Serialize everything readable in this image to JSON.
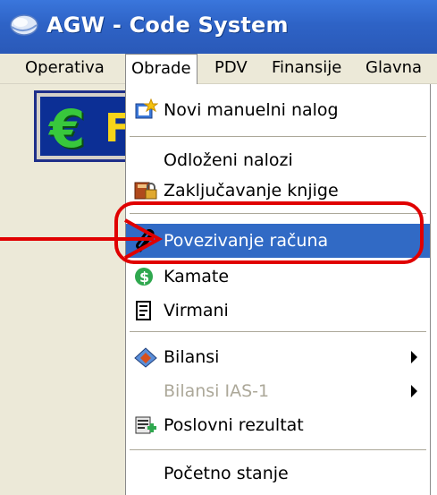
{
  "titlebar": {
    "title": "AGW - Code System",
    "icon": "app-globe-icon"
  },
  "menubar": {
    "items": [
      {
        "label": "Operativa"
      },
      {
        "label": "Obrade",
        "active": true
      },
      {
        "label": "PDV"
      },
      {
        "label": "Finansije"
      },
      {
        "label": "Glavna"
      }
    ]
  },
  "toolbar": {
    "button_icon": "euro-icon",
    "button_text": "F"
  },
  "dropdown": {
    "items": [
      {
        "label": "Novi manuelni nalog",
        "icon": "new-document-icon"
      },
      {
        "label": "Odloženi nalozi"
      },
      {
        "label": "Zaključavanje knjige",
        "icon": "lock-book-icon"
      },
      {
        "label": "Povezivanje računa",
        "icon": "paperclip-icon",
        "highlighted": true
      },
      {
        "label": "Kamate",
        "icon": "dollar-icon"
      },
      {
        "label": "Virmani",
        "icon": "document-icon"
      },
      {
        "label": "Bilansi",
        "icon": "balance-icon",
        "submenu": true
      },
      {
        "label": "Bilansi IAS-1",
        "disabled": true,
        "submenu": true
      },
      {
        "label": "Poslovni rezultat",
        "icon": "report-icon"
      },
      {
        "label": "Početno stanje"
      }
    ]
  },
  "colors": {
    "highlight": "#316ac5",
    "callout": "#e00000",
    "menubar": "#ece9d8"
  }
}
